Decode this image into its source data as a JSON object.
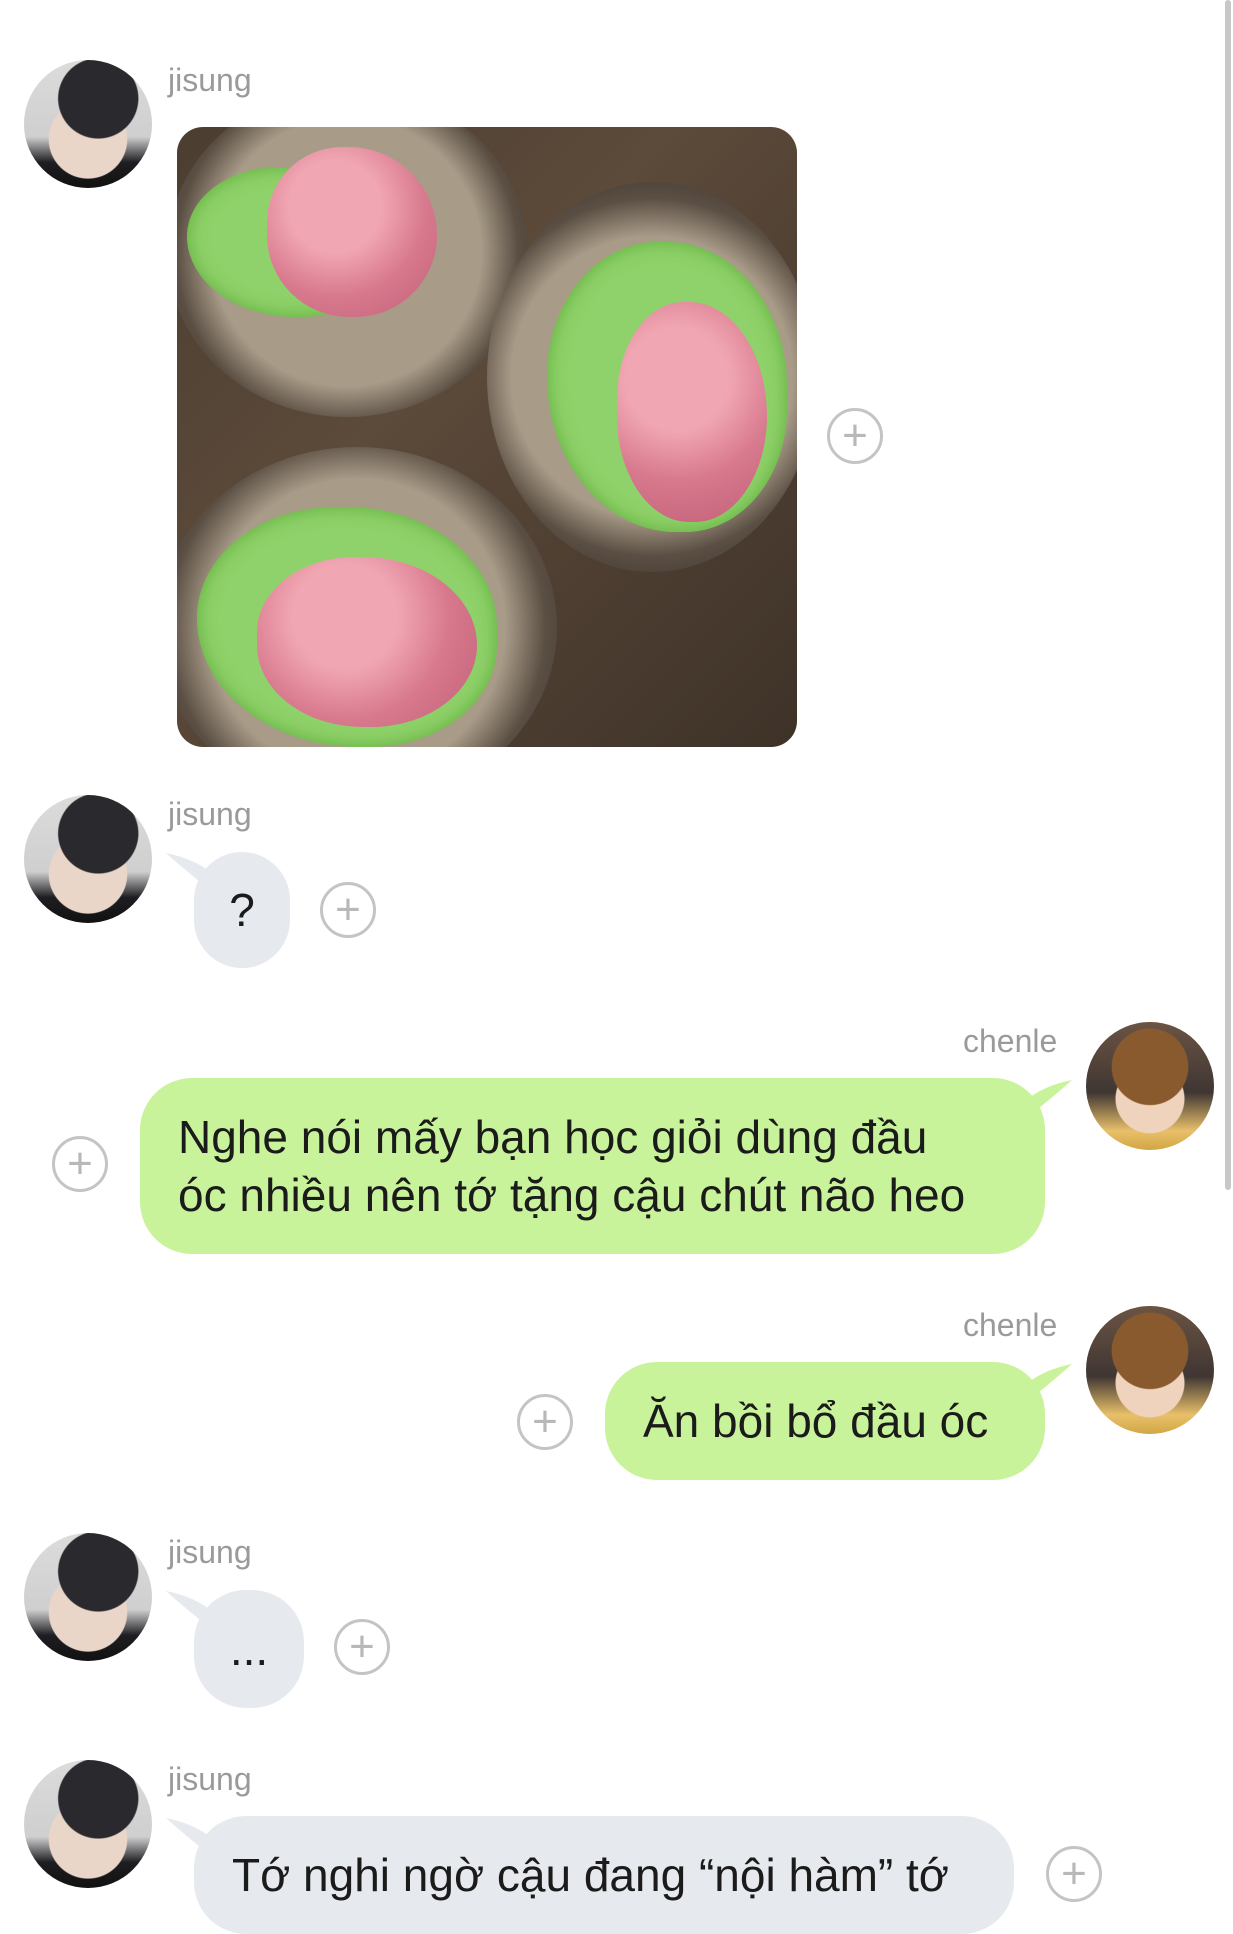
{
  "messages": [
    {
      "sender": "jisung",
      "type": "image",
      "alt": ""
    },
    {
      "sender": "jisung",
      "type": "text",
      "text": "?"
    },
    {
      "sender": "chenle",
      "type": "text",
      "lines": [
        "Nghe nói mấy bạn học giỏi dùng đầu",
        "óc nhiều nên tớ tặng cậu chút não heo"
      ]
    },
    {
      "sender": "chenle",
      "type": "text",
      "text": "Ăn bồi bổ đầu óc"
    },
    {
      "sender": "jisung",
      "type": "text",
      "text": "..."
    },
    {
      "sender": "jisung",
      "type": "text",
      "text": "Tớ nghi ngờ cậu đang “nội hàm” tớ"
    }
  ],
  "colors": {
    "incoming_bubble": "#e6e9ee",
    "outgoing_bubble": "#c9f39a",
    "sender_name": "#9a9a9a"
  },
  "icons": {
    "reaction": "plus-circle-icon"
  }
}
